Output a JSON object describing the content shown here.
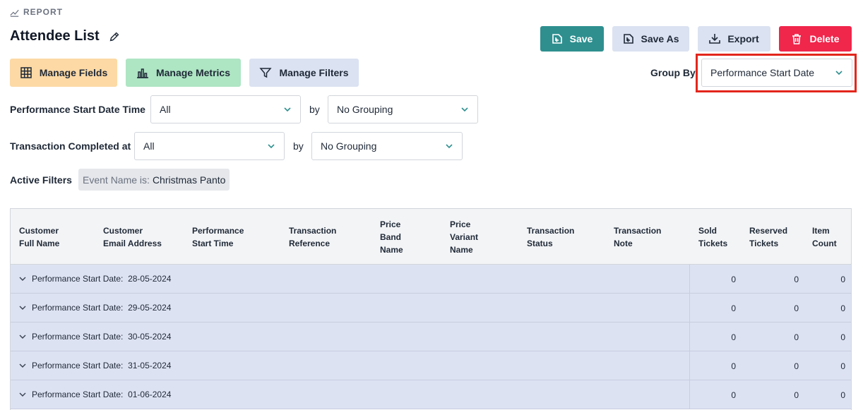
{
  "header": {
    "kicker": "REPORT",
    "title": "Attendee List"
  },
  "toolbar": {
    "save_label": "Save",
    "save_as_label": "Save As",
    "export_label": "Export",
    "delete_label": "Delete"
  },
  "manage": {
    "fields_label": "Manage Fields",
    "metrics_label": "Manage Metrics",
    "filters_label": "Manage Filters"
  },
  "group_by": {
    "label": "Group By",
    "value": "Performance Start Date"
  },
  "date_filters": [
    {
      "label": "Performance Start Date Time",
      "value": "All",
      "by_label": "by",
      "grouping": "No Grouping"
    },
    {
      "label": "Transaction Completed at",
      "value": "All",
      "by_label": "by",
      "grouping": "No Grouping"
    }
  ],
  "active_filters": {
    "label": "Active Filters",
    "chips": [
      {
        "key": "Event Name is:",
        "value": "Christmas Panto"
      }
    ]
  },
  "table": {
    "columns": [
      [
        "Customer",
        "Full Name"
      ],
      [
        "Customer",
        "Email Address"
      ],
      [
        "Performance",
        "Start Time"
      ],
      [
        "Transaction",
        "Reference"
      ],
      [
        "Price",
        "Band",
        "Name"
      ],
      [
        "Price",
        "Variant",
        "Name"
      ],
      [
        "Transaction",
        "Status"
      ],
      [
        "Transaction",
        "Note"
      ],
      [
        "Sold",
        "Tickets"
      ],
      [
        "Reserved",
        "Tickets"
      ],
      [
        "Item",
        "Count"
      ]
    ],
    "group_prefix": "Performance Start Date:",
    "groups": [
      {
        "date": "28-05-2024",
        "sold": "0",
        "reserved": "0",
        "items": "0"
      },
      {
        "date": "29-05-2024",
        "sold": "0",
        "reserved": "0",
        "items": "0"
      },
      {
        "date": "30-05-2024",
        "sold": "0",
        "reserved": "0",
        "items": "0"
      },
      {
        "date": "31-05-2024",
        "sold": "0",
        "reserved": "0",
        "items": "0"
      },
      {
        "date": "01-06-2024",
        "sold": "0",
        "reserved": "0",
        "items": "0"
      }
    ]
  },
  "colors": {
    "save": "#2f8f8f",
    "secondary": "#dbe2f1",
    "delete": "#f0264b",
    "fields": "#fcd9a5",
    "metrics": "#aee5c3",
    "group_row": "#dde2f2",
    "highlight": "#e3261c"
  },
  "icons": {
    "kicker": "trending-up-icon",
    "edit": "pencil-icon",
    "save": "save-icon",
    "save_as": "save-as-icon",
    "export": "download-icon",
    "delete": "trash-icon",
    "fields": "grid-icon",
    "metrics": "bar-chart-icon",
    "filters": "filter-icon",
    "dropdown": "chevron-down-icon"
  }
}
